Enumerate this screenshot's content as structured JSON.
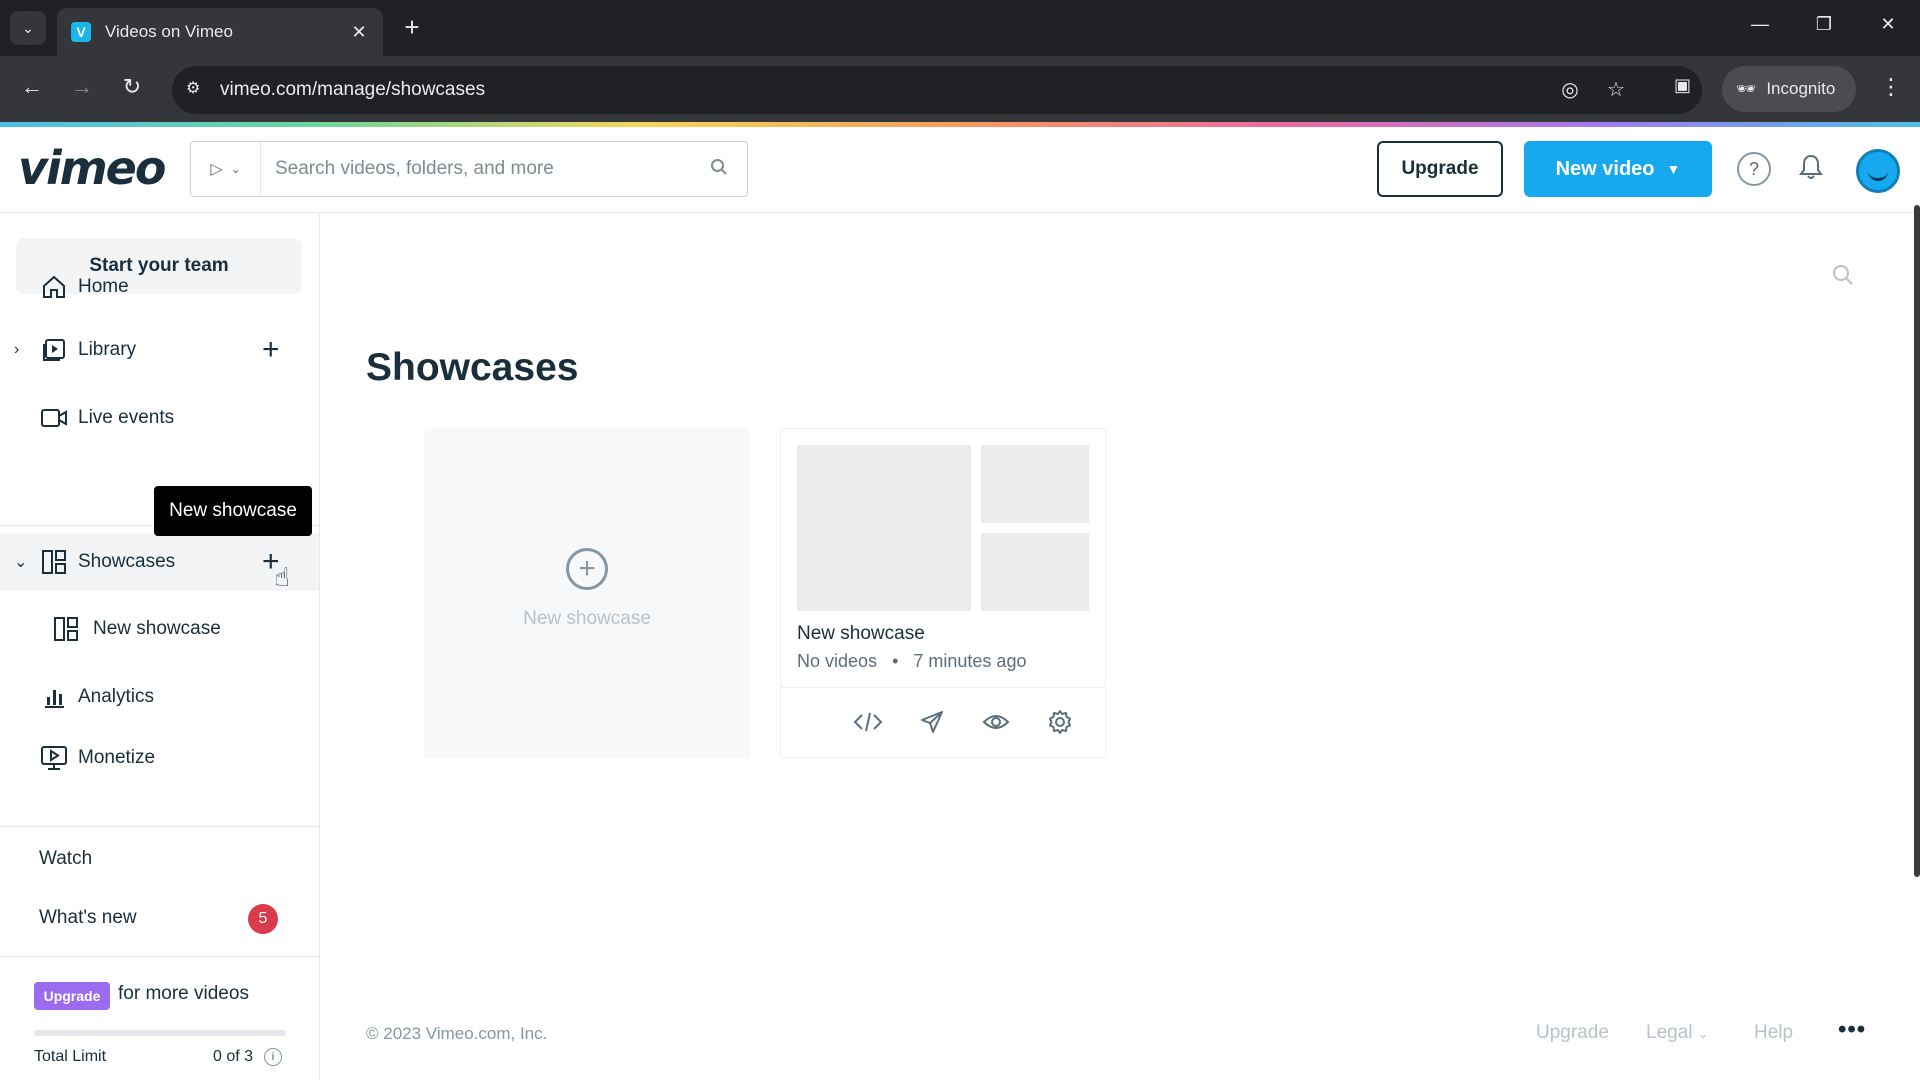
{
  "browser": {
    "tab_title": "Videos on Vimeo",
    "url": "vimeo.com/manage/showcases",
    "incognito_label": "Incognito"
  },
  "header": {
    "logo": "vimeo",
    "search_placeholder": "Search videos, folders, and more",
    "upgrade_label": "Upgrade",
    "new_video_label": "New video"
  },
  "sidebar": {
    "team_button": "Start your team",
    "items": {
      "home": "Home",
      "library": "Library",
      "live_events": "Live events",
      "showcases": "Showcases",
      "new_showcase": "New showcase",
      "analytics": "Analytics",
      "monetize": "Monetize"
    },
    "watch": "Watch",
    "whats_new": "What's new",
    "whats_new_badge": "5",
    "upgrade_chip": "Upgrade",
    "upgrade_text": "for more videos",
    "limit_label": "Total Limit",
    "limit_count": "0 of 3",
    "limit_progress": 0
  },
  "tooltip": "New showcase",
  "main": {
    "title": "Showcases",
    "new_card_label": "New showcase",
    "showcase": {
      "title": "New showcase",
      "videos": "No videos",
      "time": "7 minutes ago"
    }
  },
  "footer": {
    "copyright": "© 2023 Vimeo.com, Inc.",
    "upgrade": "Upgrade",
    "legal": "Legal",
    "help": "Help"
  },
  "colors": {
    "accent": "#17a9ef",
    "badge": "#d93b4c",
    "upgrade_chip": "#9c6cf0"
  }
}
